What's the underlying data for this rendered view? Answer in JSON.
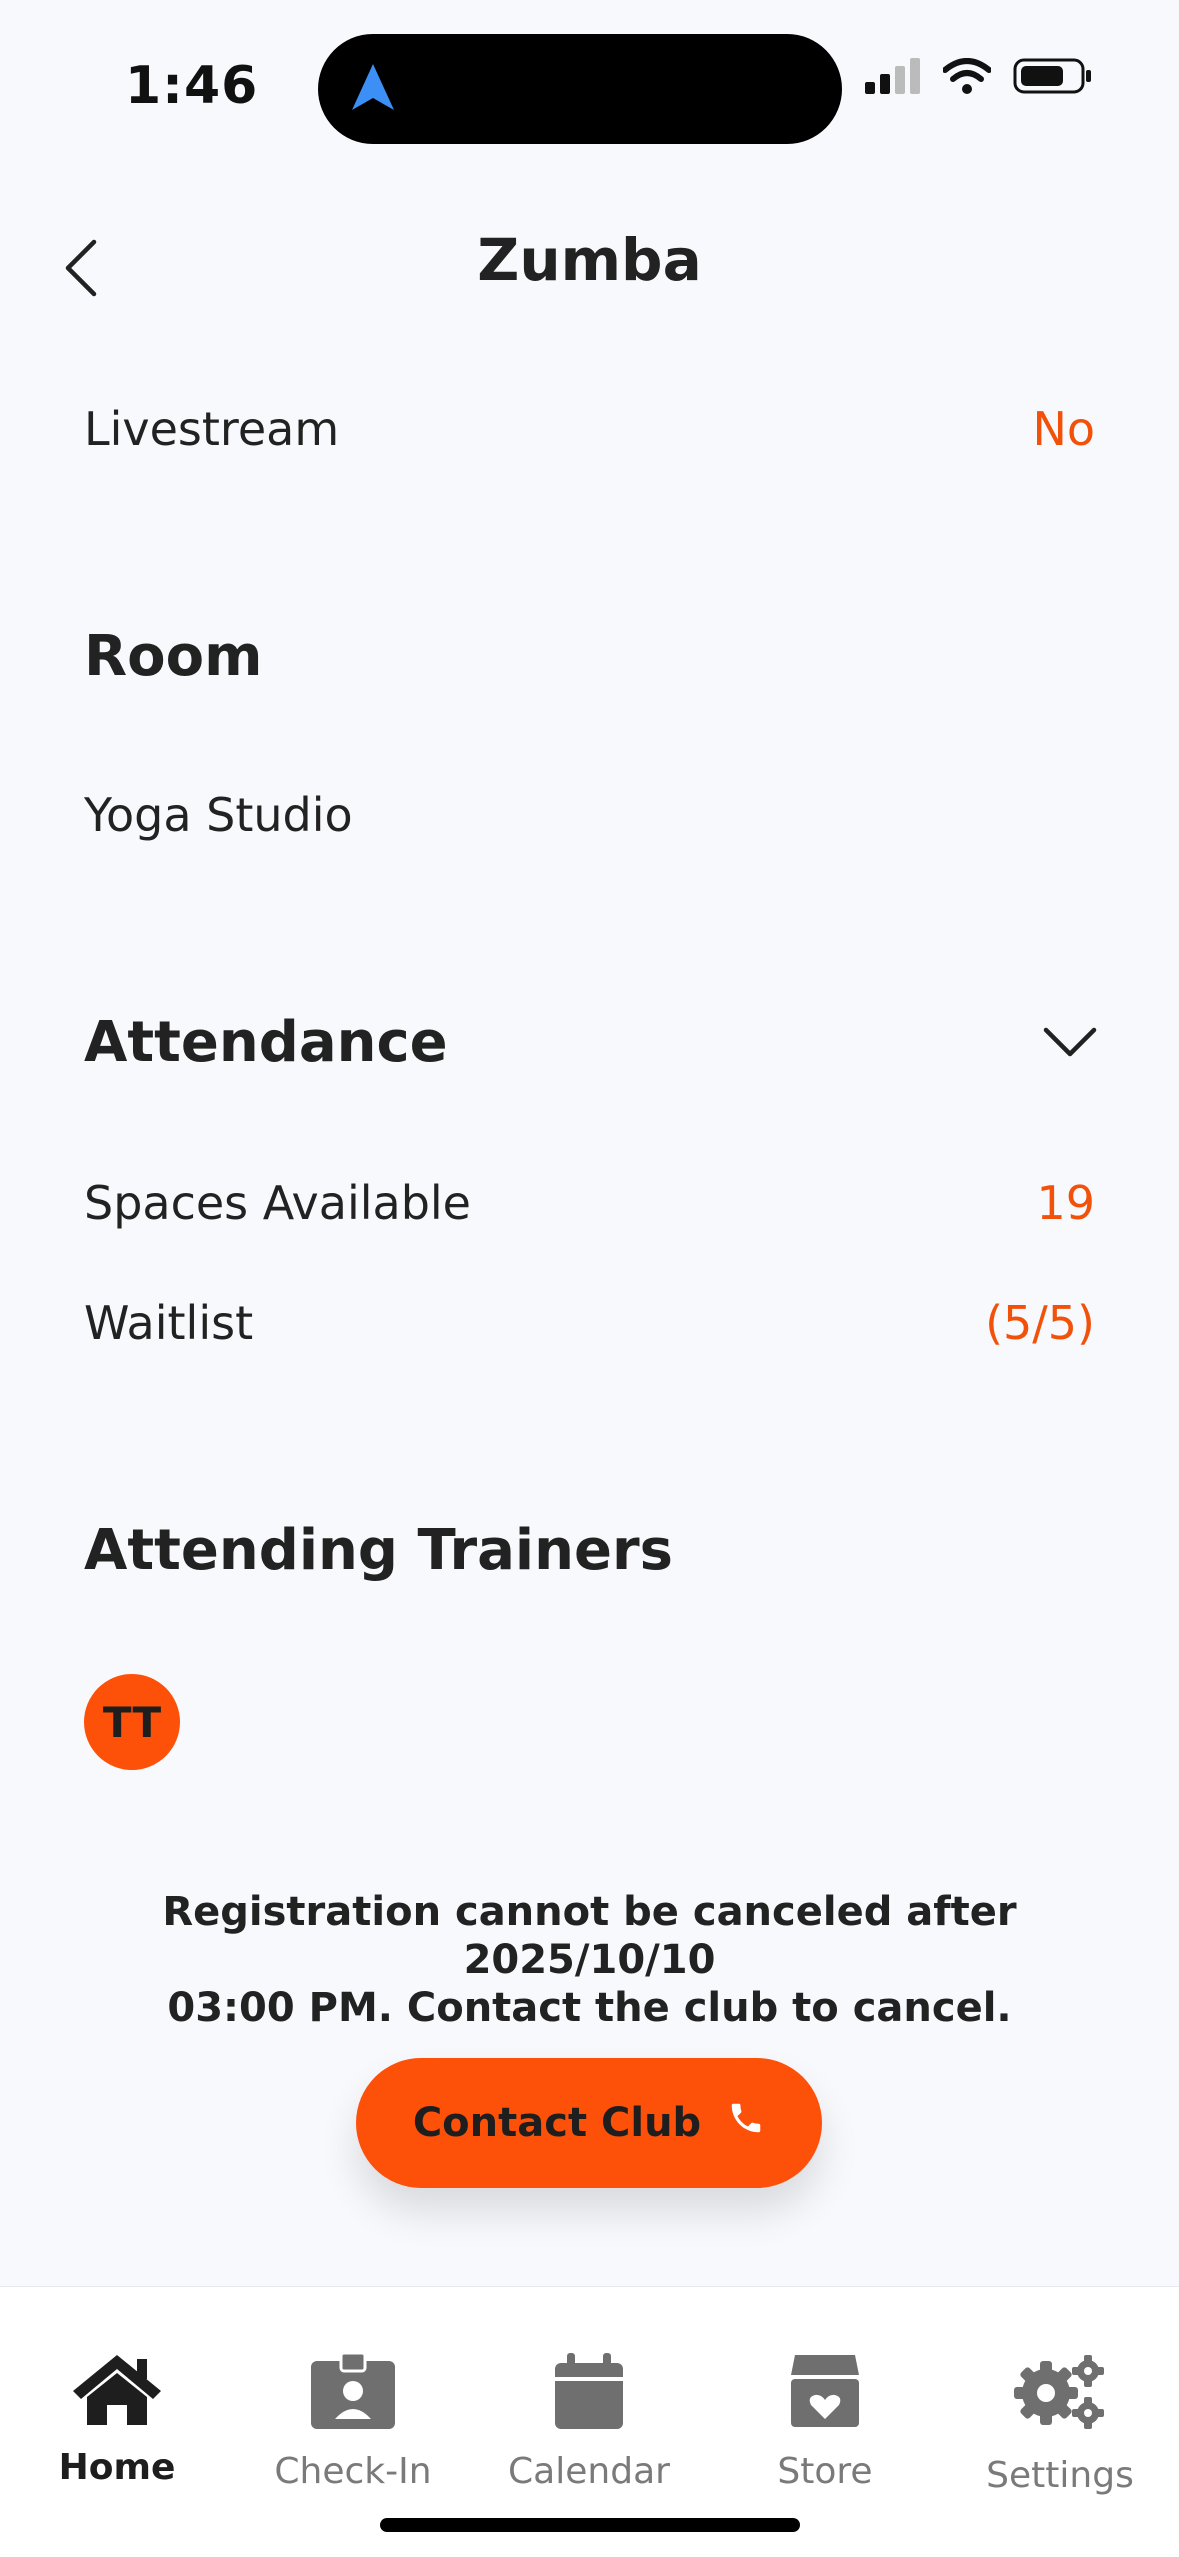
{
  "status": {
    "time": "1:46"
  },
  "header": {
    "title": "Zumba"
  },
  "livestream": {
    "label": "Livestream",
    "value": "No"
  },
  "room": {
    "heading": "Room",
    "name": "Yoga Studio"
  },
  "attendance": {
    "heading": "Attendance",
    "spaces_label": "Spaces Available",
    "spaces_value": "19",
    "waitlist_label": "Waitlist",
    "waitlist_value": "(5/5)"
  },
  "trainers": {
    "heading": "Attending Trainers",
    "initials": "TT"
  },
  "notice": {
    "line1": "Registration cannot be canceled after 2025/10/10",
    "line2": "03:00 PM. Contact the club to cancel."
  },
  "contact_button": {
    "label": "Contact Club",
    "icon": "phone-icon"
  },
  "tabs": [
    {
      "label": "Home",
      "icon": "home-icon",
      "active": true
    },
    {
      "label": "Check-In",
      "icon": "badge-icon",
      "active": false
    },
    {
      "label": "Calendar",
      "icon": "calendar-icon",
      "active": false
    },
    {
      "label": "Store",
      "icon": "store-box-icon",
      "active": false
    },
    {
      "label": "Settings",
      "icon": "gears-icon",
      "active": false
    }
  ],
  "colors": {
    "accent": "#fd5008",
    "accent_text": "#f2510a",
    "background": "#f8f9fd",
    "tab_inactive": "#7a7a7a"
  }
}
